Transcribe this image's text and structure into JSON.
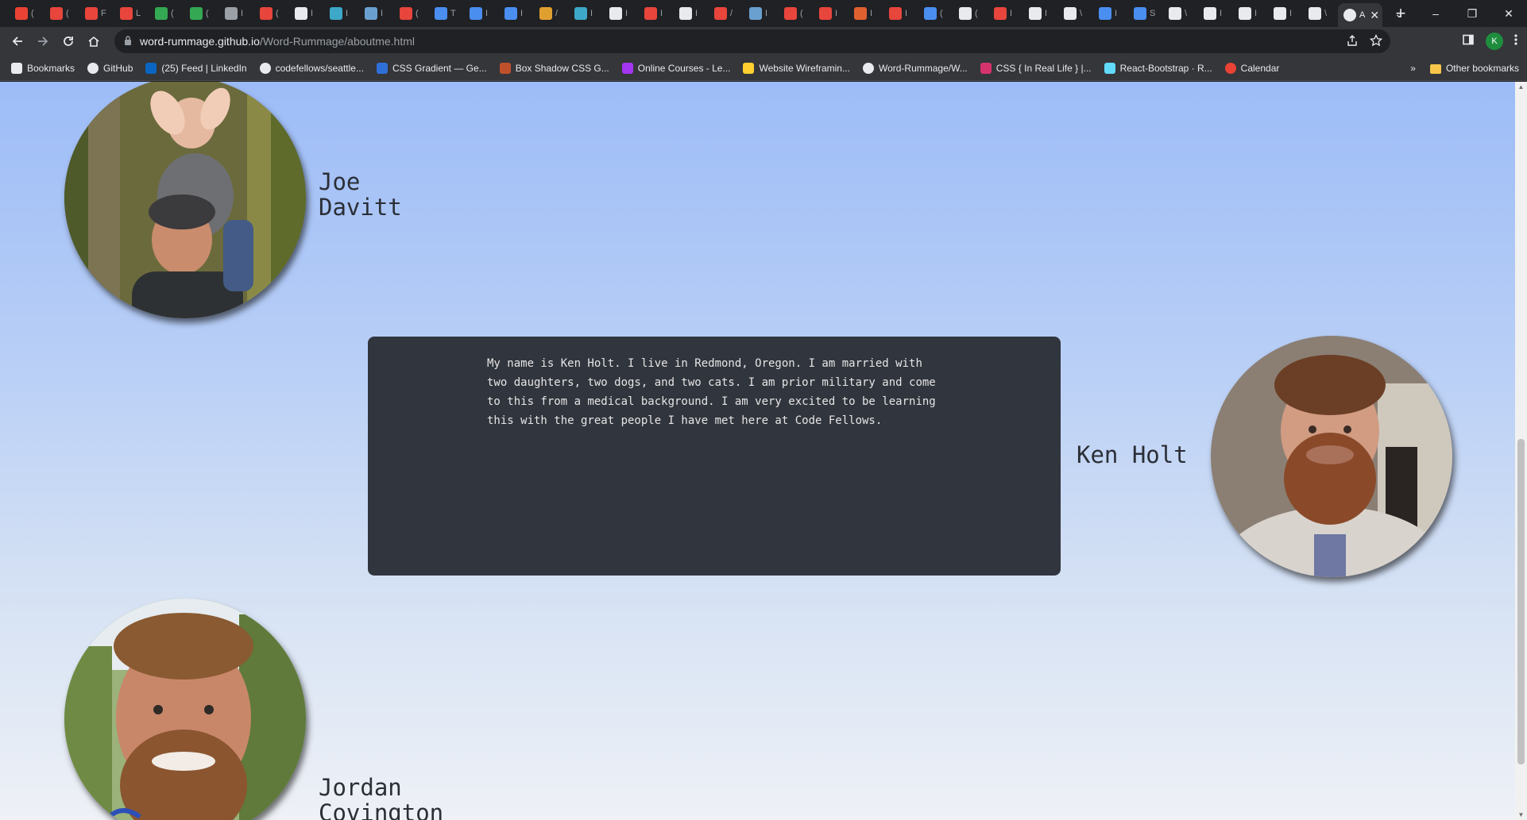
{
  "browser": {
    "active_tab": {
      "title": "A",
      "close_glyph": "✕"
    },
    "tab_letters": [
      "(",
      "(",
      "F",
      "L",
      "(",
      "(",
      "I",
      "(",
      "I",
      "I",
      "I",
      "(",
      "T",
      "I",
      "I",
      "/",
      "I",
      "I",
      "I",
      "I",
      "/",
      "I",
      "(",
      "I",
      "I",
      "I",
      "(",
      "(",
      "I",
      "I",
      "\\",
      "I",
      "S",
      "\\",
      "I",
      "I",
      "I",
      "\\"
    ],
    "new_tab_glyph": "+",
    "window_controls": [
      "⌄",
      "–",
      "❐",
      "✕"
    ],
    "url_host": "word-rummage.github.io",
    "url_path": "/Word-Rummage/aboutme.html",
    "profile_initial": "K",
    "colors": {
      "tabstrip": "#202124",
      "toolbar": "#35363a",
      "profile": "#1e8e3e"
    }
  },
  "bookmarks": {
    "items": [
      {
        "label": "Bookmarks",
        "icon": "star-icon",
        "color": "#e8eaed"
      },
      {
        "label": "GitHub",
        "icon": "github-icon",
        "color": "#e8eaed"
      },
      {
        "label": "(25) Feed | LinkedIn",
        "icon": "linkedin-icon",
        "color": "#0a66c2"
      },
      {
        "label": "codefellows/seattle...",
        "icon": "github-icon",
        "color": "#e8eaed"
      },
      {
        "label": "CSS Gradient — Ge...",
        "icon": "css-gradient-icon",
        "color": "#2f6fd8"
      },
      {
        "label": "Box Shadow CSS G...",
        "icon": "box-shadow-icon",
        "color": "#c0502b"
      },
      {
        "label": "Online Courses - Le...",
        "icon": "udemy-icon",
        "color": "#a435f0"
      },
      {
        "label": "Website Wireframin...",
        "icon": "miro-icon",
        "color": "#ffd02f"
      },
      {
        "label": "Word-Rummage/W...",
        "icon": "github-icon",
        "color": "#e8eaed"
      },
      {
        "label": "CSS { In Real Life } |...",
        "icon": "css-irl-icon",
        "color": "#d6336c"
      },
      {
        "label": "React-Bootstrap · R...",
        "icon": "react-icon",
        "color": "#61dafb"
      },
      {
        "label": "Calendar",
        "icon": "calendar-icon",
        "color": "#ea4335"
      }
    ],
    "overflow": "»",
    "other": "Other bookmarks"
  },
  "team": [
    {
      "name_line1": "Joe",
      "name_line2": "Davitt"
    },
    {
      "name": "Ken Holt",
      "bio": "My name is Ken Holt. I live in Redmond, Oregon. I am married with two daughters, two dogs, and two cats. I am prior military and come to this from a medical background. I am very excited to be learning this with the great people I have met here at Code Fellows."
    },
    {
      "name_line1": "Jordan",
      "name_line2": "Covington"
    }
  ],
  "page_colors": {
    "gradient_top": "#9dbcf7",
    "gradient_bottom": "#eef1f6",
    "card": "#31353d",
    "card_text": "#e6e6e6",
    "name_text": "#2b2f36"
  }
}
